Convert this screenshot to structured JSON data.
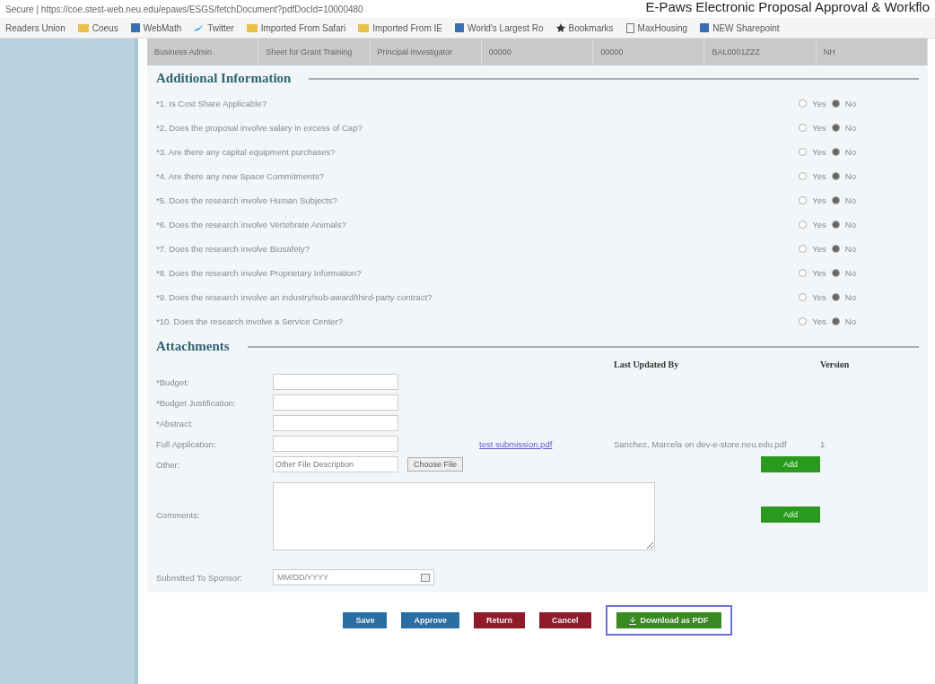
{
  "browser": {
    "address": "Secure | https://coe.stest-web.neu.edu/epaws/ESGS/fetchDocument?pdfDocId=10000480",
    "page_title": "E-Paws Electronic Proposal Approval & Workflo"
  },
  "bookmarks": [
    {
      "label": "Readers Union",
      "kind": "plain"
    },
    {
      "label": "Coeus",
      "kind": "folder"
    },
    {
      "label": "WebMath",
      "kind": "site"
    },
    {
      "label": "Twitter",
      "kind": "bird"
    },
    {
      "label": "Imported From Safari",
      "kind": "folder"
    },
    {
      "label": "Imported From IE",
      "kind": "folder"
    },
    {
      "label": "World's Largest Ro",
      "kind": "site"
    },
    {
      "label": "Bookmarks",
      "kind": "star"
    },
    {
      "label": "MaxHousing",
      "kind": "page"
    },
    {
      "label": "NEW Sharepoint",
      "kind": "site"
    }
  ],
  "summary_row": [
    "Business Admin",
    "Sheet for Grant Training",
    "Principal Investigator",
    "00000",
    "00000",
    "BAL0001ZZZ",
    "NH"
  ],
  "additional_information": {
    "title": "Additional Information",
    "questions": [
      {
        "text": "*1. Is Cost Share Applicable?",
        "yes": false,
        "yes_label": "Yes",
        "no_label": "No"
      },
      {
        "text": "*2. Does the proposal involve salary in excess of Cap?",
        "yes": false,
        "yes_label": "Yes",
        "no_label": "No"
      },
      {
        "text": "*3. Are there any capital equipment purchases?",
        "yes": false,
        "yes_label": "Yes",
        "no_label": "No"
      },
      {
        "text": "*4. Are there any new Space Commitments?",
        "yes": false,
        "yes_label": "Yes",
        "no_label": "No"
      },
      {
        "text": "*5. Does the research involve Human Subjects?",
        "yes": false,
        "yes_label": "Yes",
        "no_label": "No"
      },
      {
        "text": "*6. Does the research involve Vertebrate Animals?",
        "yes": false,
        "yes_label": "Yes",
        "no_label": "No"
      },
      {
        "text": "*7. Does the research involve Biosafety?",
        "yes": false,
        "yes_label": "Yes",
        "no_label": "No"
      },
      {
        "text": "*8. Does the research involve Proprietary Information?",
        "yes": false,
        "yes_label": "Yes",
        "no_label": "No"
      },
      {
        "text": "*9. Does the research involve an industry/sub-award/third-party contract?",
        "yes": false,
        "yes_label": "Yes",
        "no_label": "No"
      },
      {
        "text": "*10. Does the research involve a Service Center?",
        "yes": false,
        "yes_label": "Yes",
        "no_label": "No"
      }
    ]
  },
  "attachments": {
    "title": "Attachments",
    "columns": [
      "Last Updated By",
      "Version"
    ],
    "rows": [
      {
        "label": "*Budget:",
        "kind": "file"
      },
      {
        "label": "*Budget Justification:",
        "kind": "file"
      },
      {
        "label": "*Abstract:",
        "kind": "file"
      },
      {
        "label": "Full Application:",
        "kind": "uploaded",
        "link": "test submission.pdf",
        "updated_by": "Sanchez, Marcela on dev-e-store.neu.edu.pdf",
        "version": "1"
      },
      {
        "label": "Other:",
        "kind": "other",
        "placeholder": "Other File Description",
        "choose": "Choose File",
        "add": "Add"
      }
    ],
    "comments_label": "Comments:",
    "comments_add": "Add",
    "sponsor_label": "Submitted To Sponsor:",
    "sponsor_placeholder": "MM/DD/YYYY"
  },
  "actions": [
    {
      "label": "Save",
      "kind": "blue",
      "highlighted": false
    },
    {
      "label": "Approve",
      "kind": "blue",
      "highlighted": false
    },
    {
      "label": "Return",
      "kind": "red",
      "highlighted": false
    },
    {
      "label": "Cancel",
      "kind": "red",
      "highlighted": false
    },
    {
      "label": "Download as PDF",
      "kind": "green",
      "highlighted": true
    }
  ]
}
